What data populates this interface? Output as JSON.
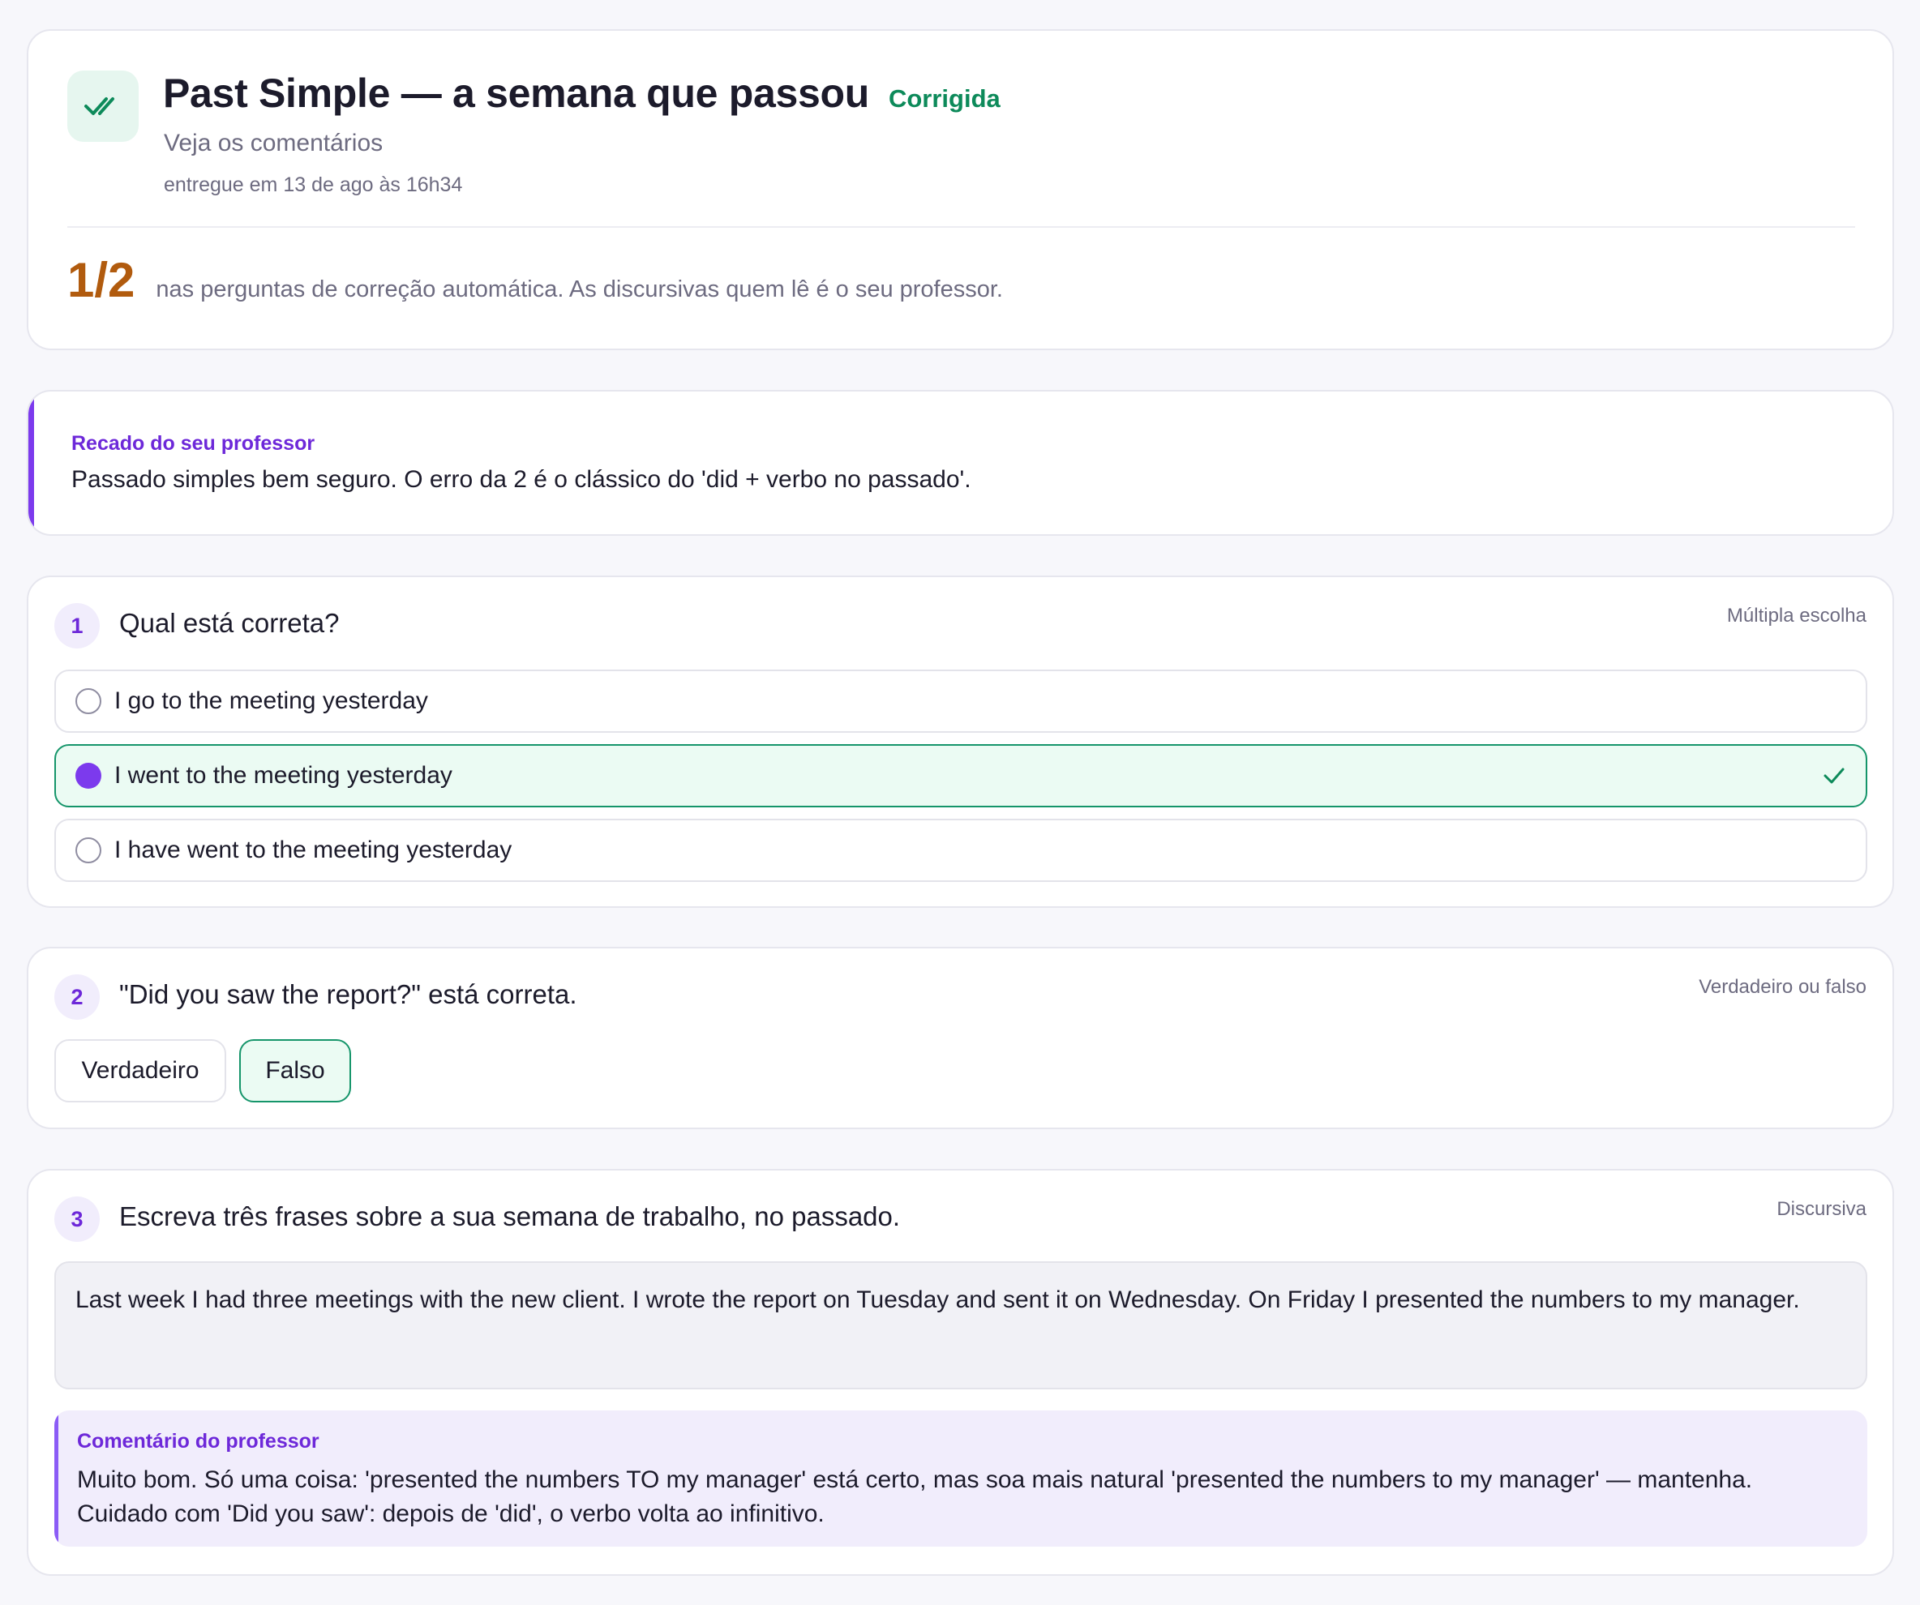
{
  "header": {
    "title": "Past Simple — a semana que passou",
    "status": "Corrigida",
    "subtitle": "Veja os comentários",
    "delivered": "entregue em 13 de ago às 16h34",
    "icon": "double-check-icon",
    "score": "1/2",
    "score_text": "nas perguntas de correção automática. As discursivas quem lê é o seu professor."
  },
  "teacher_note": {
    "label": "Recado do seu professor",
    "text": "Passado simples bem seguro. O erro da 2 é o clássico do 'did + verbo no passado'."
  },
  "questions": [
    {
      "number": "1",
      "text": "Qual está correta?",
      "type": "Múltipla escolha",
      "options": [
        {
          "label": "I go to the meeting yesterday",
          "selected": false
        },
        {
          "label": "I went to the meeting yesterday",
          "selected": true,
          "correct": true
        },
        {
          "label": "I have went to the meeting yesterday",
          "selected": false
        }
      ]
    },
    {
      "number": "2",
      "text": "\"Did you saw the report?\" está correta.",
      "type": "Verdadeiro ou falso",
      "options": [
        {
          "label": "Verdadeiro",
          "selected": false
        },
        {
          "label": "Falso",
          "selected": true
        }
      ]
    },
    {
      "number": "3",
      "text": "Escreva três frases sobre a sua semana de trabalho, no passado.",
      "type": "Discursiva",
      "answer": "Last week I had three meetings with the new client. I wrote the report on Tuesday and sent it on Wednesday. On Friday I presented the numbers to my manager.",
      "comment_label": "Comentário do professor",
      "comment": "Muito bom. Só uma coisa: 'presented the numbers TO my manager' está certo, mas soa mais natural 'presented the numbers to my manager' — mantenha. Cuidado com 'Did you saw': depois de 'did', o verbo volta ao infinitivo."
    }
  ],
  "colors": {
    "accent": "#7c3aed",
    "success": "#0d8a5a",
    "score": "#b15b0e",
    "muted": "#6d6b80"
  }
}
